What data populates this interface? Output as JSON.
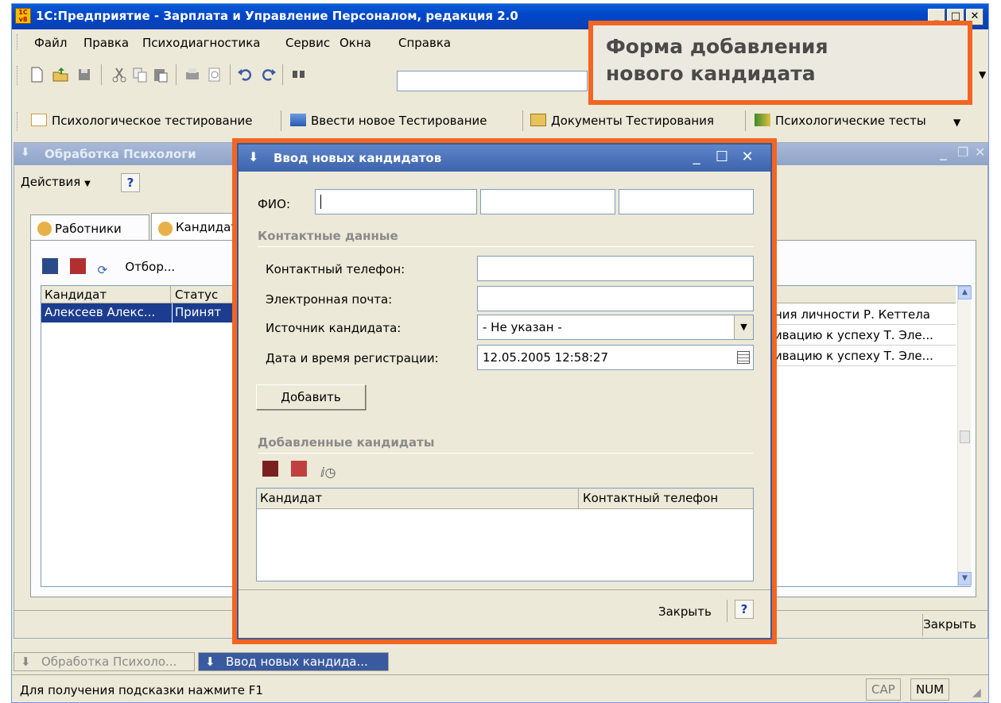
{
  "app": {
    "title": "1С:Предприятие - Зарплата и Управление Персоналом, редакция 2.0",
    "icon_text": "1С v8"
  },
  "menu": [
    "Файл",
    "Правка",
    "Психодиагностика",
    "Сервис",
    "Окна",
    "Справка"
  ],
  "toolbar2": [
    "Психологическое тестирование",
    "Ввести новое Тестирование",
    "Документы Тестирования",
    "Психологические тесты"
  ],
  "callout": {
    "line1": "Форма добавления",
    "line2": "нового кандидата"
  },
  "subwindow": {
    "title": "Обработка Психологи",
    "actions_label": "Действия",
    "help": "?",
    "tabs": [
      "Работники",
      "Кандидаты"
    ],
    "filter_label": "Отбор...",
    "grid": {
      "columns": [
        "Кандидат",
        "Статус"
      ],
      "selected_row": [
        "Алексеев Алекс...",
        "Принят"
      ],
      "right_rows": [
        "ния личности Р. Кеттела",
        "ивацию к успеху Т. Эле...",
        "ивацию к успеху Т. Эле..."
      ]
    },
    "close_label": "Закрыть"
  },
  "dialog": {
    "title": "Ввод новых кандидатов",
    "fio_label": "ФИО:",
    "contacts_section": "Контактные данные",
    "phone_label": "Контактный телефон:",
    "email_label": "Электронная почта:",
    "source_label": "Источник кандидата:",
    "source_value": "- Не указан -",
    "regdate_label": "Дата и время регистрации:",
    "regdate_value": "12.05.2005 12:58:27",
    "add_button": "Добавить",
    "added_section": "Добавленные кандидаты",
    "grid_columns": [
      "Кандидат",
      "Контактный телефон"
    ],
    "close_button": "Закрыть",
    "help": "?"
  },
  "taskbar": [
    "Обработка  Психоло...",
    "Ввод новых кандида..."
  ],
  "status": {
    "hint": "Для получения подсказки нажмите F1",
    "cap": "CAP",
    "num": "NUM"
  },
  "colors": {
    "highlight": "#f26522",
    "title_blue": "#0047c9",
    "selection": "#1c3d8f"
  }
}
